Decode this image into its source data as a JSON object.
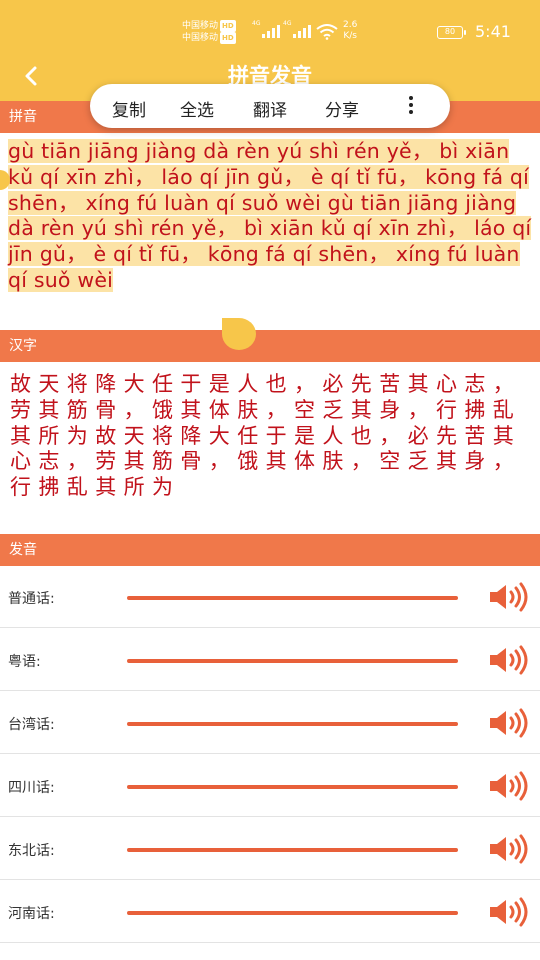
{
  "status_bar": {
    "carrier1": "中国移动",
    "carrier2": "中国移动",
    "hd_badge": "HD",
    "net_type": "4G",
    "net_speed_value": "2.6",
    "net_speed_unit": "K/s",
    "battery": "80",
    "time": "5:41"
  },
  "header": {
    "title": "拼音发音",
    "back_icon": "chevron-left-icon"
  },
  "context_menu": {
    "copy": "复制",
    "select_all": "全选",
    "translate": "翻译",
    "share": "分享",
    "more_icon": "more-vertical-icon"
  },
  "sections": {
    "pinyin": "拼音",
    "hanzi": "汉字",
    "pronunciation": "发音"
  },
  "pinyin_text": "gù tiān jiāng jiàng dà rèn yú shì rén yě， bì xiān kǔ qí xīn zhì， láo qí jīn gǔ， è qí tǐ fū， kōng fá qí shēn， xíng fú luàn qí suǒ wèi gù tiān jiāng jiàng dà rèn yú shì rén yě， bì xiān kǔ qí xīn zhì， láo qí jīn gǔ， è qí tǐ fū， kōng fá qí shēn， xíng fú luàn qí suǒ wèi",
  "hanzi_text": "故天将降大任于是人也，必先苦其心志，劳其筋骨，饿其体肤，空乏其身，行拂乱其所为故天将降大任于是人也，必先苦其心志，劳其筋骨，饿其体肤，空乏其身，行拂乱其所为",
  "dialects": [
    {
      "label": "普通话:",
      "icon": "speaker-icon"
    },
    {
      "label": "粤语:",
      "icon": "speaker-icon"
    },
    {
      "label": "台湾话:",
      "icon": "speaker-icon"
    },
    {
      "label": "四川话:",
      "icon": "speaker-icon"
    },
    {
      "label": "东北话:",
      "icon": "speaker-icon"
    },
    {
      "label": "河南话:",
      "icon": "speaker-icon"
    }
  ],
  "colors": {
    "header_yellow": "#f7c64a",
    "section_orange": "#f0784a",
    "text_red": "#c1121b",
    "selection_bg": "#fce3a6",
    "bar_orange": "#e8603a"
  }
}
